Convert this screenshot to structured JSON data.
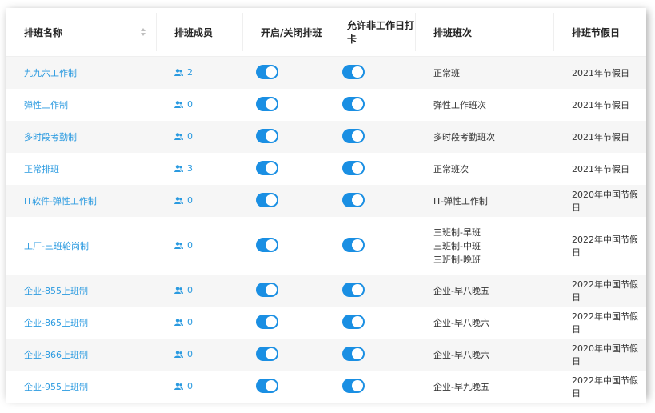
{
  "table": {
    "headers": {
      "name": "排班名称",
      "members": "排班成员",
      "toggle_schedule": "开启/关闭排班",
      "allow_nonworkday": "允许非工作日打卡",
      "shifts": "排班班次",
      "holidays": "排班节假日"
    },
    "rows": [
      {
        "name": "九九六工作制",
        "members": "2",
        "schedule_on": true,
        "nonworkday_on": true,
        "shifts": [
          "正常班"
        ],
        "holiday": "2021年节假日"
      },
      {
        "name": "弹性工作制",
        "members": "0",
        "schedule_on": true,
        "nonworkday_on": true,
        "shifts": [
          "弹性工作班次"
        ],
        "holiday": "2021年节假日"
      },
      {
        "name": "多时段考勤制",
        "members": "0",
        "schedule_on": true,
        "nonworkday_on": true,
        "shifts": [
          "多时段考勤班次"
        ],
        "holiday": "2021年节假日"
      },
      {
        "name": "正常排班",
        "members": "3",
        "schedule_on": true,
        "nonworkday_on": true,
        "shifts": [
          "正常班次"
        ],
        "holiday": "2021年节假日"
      },
      {
        "name": "IT软件-弹性工作制",
        "members": "0",
        "schedule_on": true,
        "nonworkday_on": true,
        "shifts": [
          "IT-弹性工作制"
        ],
        "holiday": "2020年中国节假日"
      },
      {
        "name": "工厂-三班轮岗制",
        "members": "0",
        "schedule_on": true,
        "nonworkday_on": true,
        "shifts": [
          "三班制-早班",
          "三班制-中班",
          "三班制-晚班"
        ],
        "holiday": "2022年中国节假日"
      },
      {
        "name": "企业-855上班制",
        "members": "0",
        "schedule_on": true,
        "nonworkday_on": true,
        "shifts": [
          "企业-早八晚五"
        ],
        "holiday": "2022年中国节假日"
      },
      {
        "name": "企业-865上班制",
        "members": "0",
        "schedule_on": true,
        "nonworkday_on": true,
        "shifts": [
          "企业-早八晚六"
        ],
        "holiday": "2022年中国节假日"
      },
      {
        "name": "企业-866上班制",
        "members": "0",
        "schedule_on": true,
        "nonworkday_on": true,
        "shifts": [
          "企业-早八晚六"
        ],
        "holiday": "2020年中国节假日"
      },
      {
        "name": "企业-955上班制",
        "members": "0",
        "schedule_on": true,
        "nonworkday_on": true,
        "shifts": [
          "企业-早九晚五"
        ],
        "holiday": "2022年中国节假日"
      }
    ]
  },
  "colors": {
    "link": "#2a9ae0",
    "toggle_on": "#1a8fe3",
    "stripe": "#f6f6f6"
  },
  "icons": {
    "members": "users-icon",
    "sort": "sort-arrows-icon"
  }
}
